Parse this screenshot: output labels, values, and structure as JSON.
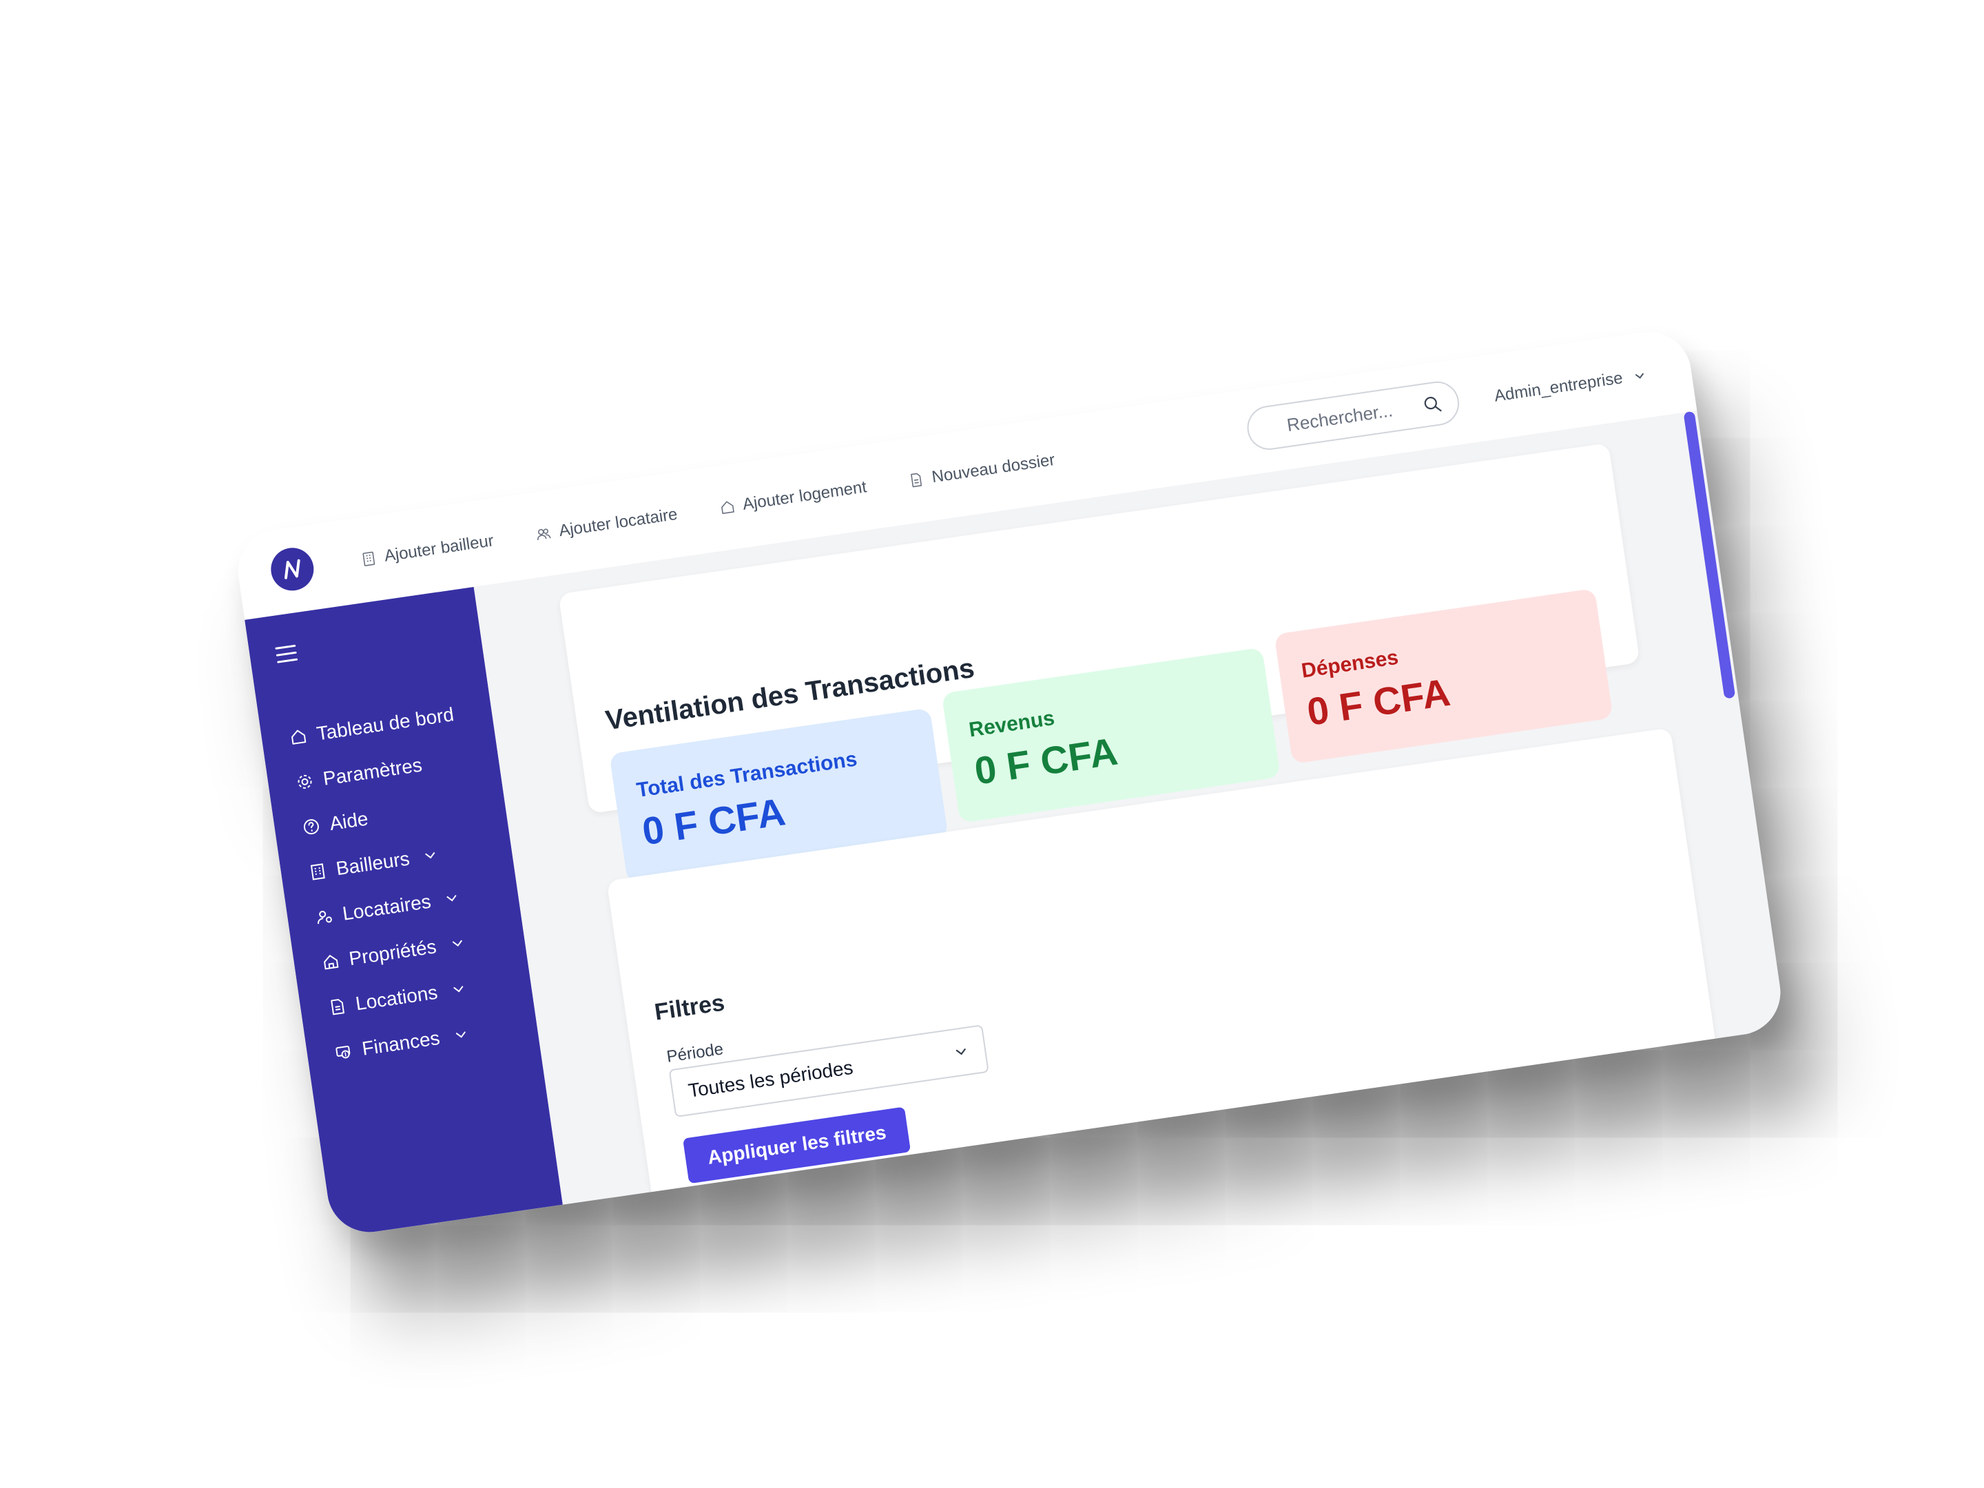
{
  "header": {
    "quick_actions": [
      {
        "label": "Ajouter bailleur",
        "icon": "building-icon"
      },
      {
        "label": "Ajouter locataire",
        "icon": "users-icon"
      },
      {
        "label": "Ajouter logement",
        "icon": "home-icon"
      },
      {
        "label": "Nouveau dossier",
        "icon": "file-icon"
      }
    ],
    "search": {
      "placeholder": "Rechercher..."
    },
    "user": {
      "name": "Admin_entreprise"
    }
  },
  "sidebar": {
    "items": [
      {
        "label": "Tableau de bord",
        "icon": "home-icon",
        "expandable": false
      },
      {
        "label": "Paramètres",
        "icon": "gear-icon",
        "expandable": false
      },
      {
        "label": "Aide",
        "icon": "help-circle-icon",
        "expandable": false
      },
      {
        "label": "Bailleurs",
        "icon": "building-icon",
        "expandable": true
      },
      {
        "label": "Locataires",
        "icon": "user-icon",
        "expandable": true
      },
      {
        "label": "Propriétés",
        "icon": "home-icon",
        "expandable": true
      },
      {
        "label": "Locations",
        "icon": "file-icon",
        "expandable": true
      },
      {
        "label": "Finances",
        "icon": "money-icon",
        "expandable": true
      }
    ]
  },
  "transactions": {
    "title": "Ventilation des Transactions",
    "total": {
      "label": "Total des Transactions",
      "value": "0 F CFA"
    },
    "revenus": {
      "label": "Revenus",
      "value": "0 F CFA"
    },
    "depenses": {
      "label": "Dépenses",
      "value": "0 F CFA"
    }
  },
  "filters": {
    "title": "Filtres",
    "period_label": "Période",
    "period_value": "Toutes les périodes",
    "apply_label": "Appliquer les filtres"
  },
  "colors": {
    "sidebar": "#3730a3",
    "accent": "#4f46e5",
    "blue": "#1d4ed8",
    "green": "#15803d",
    "red": "#b91c1c"
  }
}
